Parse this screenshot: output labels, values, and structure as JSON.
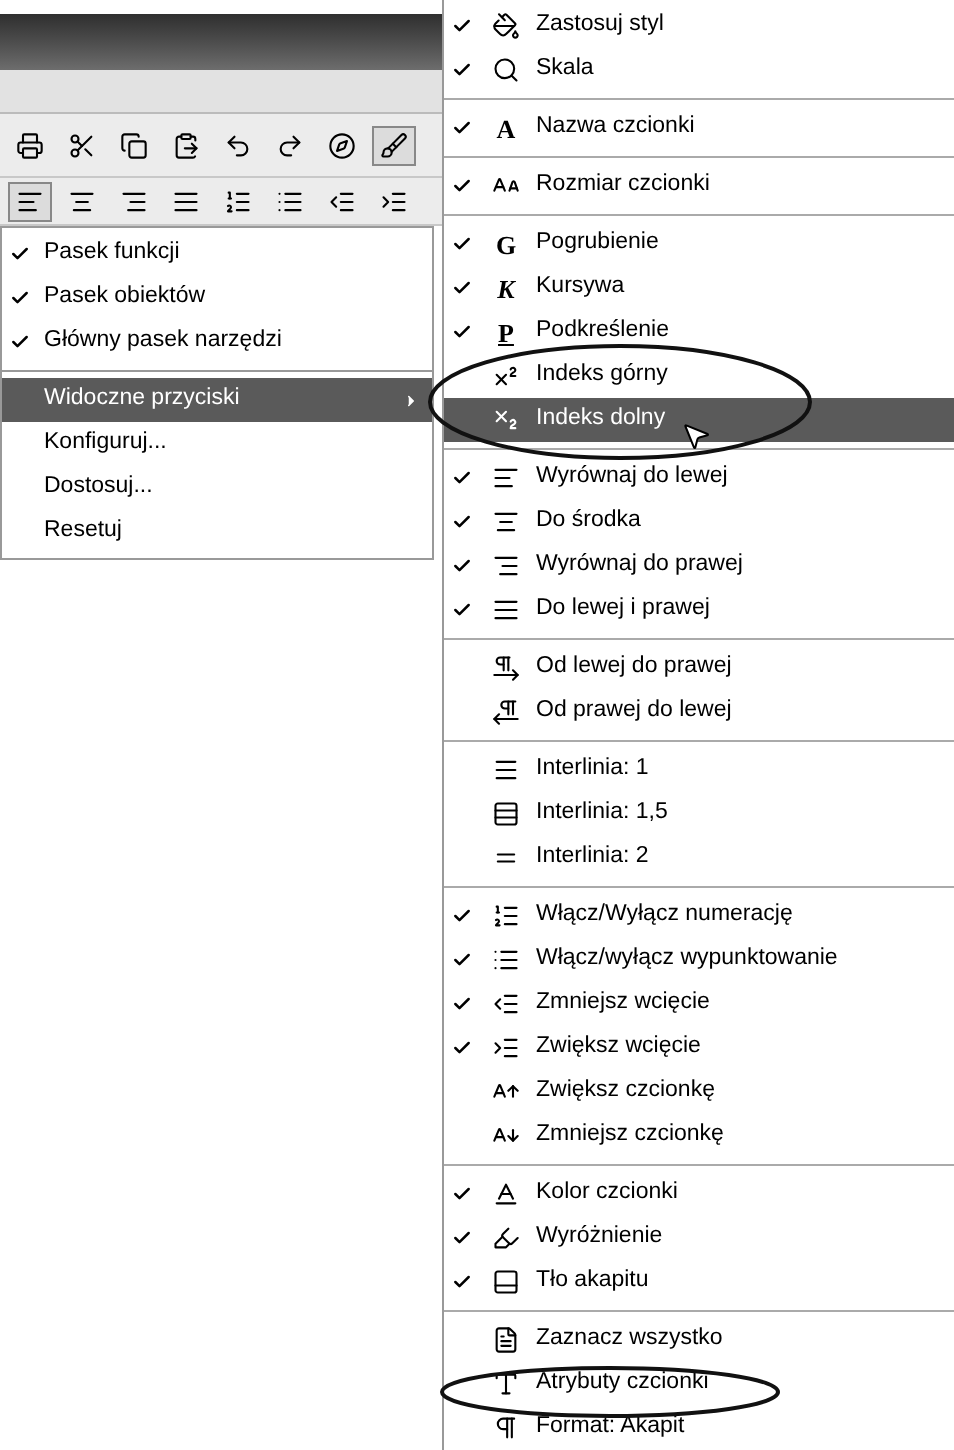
{
  "toolbar_rows": [
    [
      {
        "selected": false
      },
      {
        "selected": false
      },
      {
        "selected": false
      },
      {
        "selected": false
      },
      {
        "selected": false
      },
      {
        "selected": false
      },
      {
        "selected": false
      },
      {
        "selected": true
      }
    ],
    [
      {
        "selected": true
      },
      {
        "selected": false
      },
      {
        "selected": false
      },
      {
        "selected": false
      },
      {
        "selected": false
      },
      {
        "selected": false
      },
      {
        "selected": false
      },
      {
        "selected": false
      }
    ]
  ],
  "context_menu": {
    "groups": [
      [
        {
          "label": "Pasek funkcji",
          "checked": true,
          "selected": false,
          "submenu": false
        },
        {
          "label": "Pasek obiektów",
          "checked": true,
          "selected": false,
          "submenu": false
        },
        {
          "label": "Główny pasek narzędzi",
          "checked": true,
          "selected": false,
          "submenu": false
        }
      ],
      [
        {
          "label": "Widoczne przyciski",
          "checked": false,
          "selected": true,
          "submenu": true
        },
        {
          "label": "Konfiguruj...",
          "checked": false,
          "selected": false,
          "submenu": false
        },
        {
          "label": "Dostosuj...",
          "checked": false,
          "selected": false,
          "submenu": false
        },
        {
          "label": "Resetuj",
          "checked": false,
          "selected": false,
          "submenu": false
        }
      ]
    ]
  },
  "submenu": {
    "groups": [
      [
        {
          "label": "Zastosuj styl",
          "checked": true,
          "selected": false
        },
        {
          "label": "Skala",
          "checked": true,
          "selected": false
        }
      ],
      [
        {
          "label": "Nazwa czcionki",
          "checked": true,
          "selected": false,
          "glyph": "A"
        }
      ],
      [
        {
          "label": "Rozmiar czcionki",
          "checked": true,
          "selected": false
        }
      ],
      [
        {
          "label": "Pogrubienie",
          "checked": true,
          "selected": false,
          "glyph": "G"
        },
        {
          "label": "Kursywa",
          "checked": true,
          "selected": false,
          "glyph": "K"
        },
        {
          "label": "Podkreślenie",
          "checked": true,
          "selected": false,
          "glyph": "P"
        },
        {
          "label": "Indeks górny",
          "checked": false,
          "selected": false
        },
        {
          "label": "Indeks dolny",
          "checked": false,
          "selected": true
        }
      ],
      [
        {
          "label": "Wyrównaj do lewej",
          "checked": true,
          "selected": false
        },
        {
          "label": "Do środka",
          "checked": true,
          "selected": false
        },
        {
          "label": "Wyrównaj do prawej",
          "checked": true,
          "selected": false
        },
        {
          "label": "Do lewej i prawej",
          "checked": true,
          "selected": false
        }
      ],
      [
        {
          "label": "Od lewej do prawej",
          "checked": false,
          "selected": false
        },
        {
          "label": "Od prawej do lewej",
          "checked": false,
          "selected": false
        }
      ],
      [
        {
          "label": "Interlinia: 1",
          "checked": false,
          "selected": false
        },
        {
          "label": "Interlinia: 1,5",
          "checked": false,
          "selected": false
        },
        {
          "label": "Interlinia: 2",
          "checked": false,
          "selected": false
        }
      ],
      [
        {
          "label": "Włącz/Wyłącz numerację",
          "checked": true,
          "selected": false
        },
        {
          "label": "Włącz/wyłącz wypunktowanie",
          "checked": true,
          "selected": false
        },
        {
          "label": "Zmniejsz wcięcie",
          "checked": true,
          "selected": false
        },
        {
          "label": "Zwiększ wcięcie",
          "checked": true,
          "selected": false
        },
        {
          "label": "Zwiększ czcionkę",
          "checked": false,
          "selected": false
        },
        {
          "label": "Zmniejsz czcionkę",
          "checked": false,
          "selected": false
        }
      ],
      [
        {
          "label": "Kolor czcionki",
          "checked": true,
          "selected": false
        },
        {
          "label": "Wyróżnienie",
          "checked": true,
          "selected": false
        },
        {
          "label": "Tło akapitu",
          "checked": true,
          "selected": false
        }
      ],
      [
        {
          "label": "Zaznacz wszystko",
          "checked": false,
          "selected": false
        },
        {
          "label": "Atrybuty czcionki",
          "checked": false,
          "selected": false
        },
        {
          "label": "Format: Akapit",
          "checked": false,
          "selected": false
        }
      ]
    ]
  }
}
